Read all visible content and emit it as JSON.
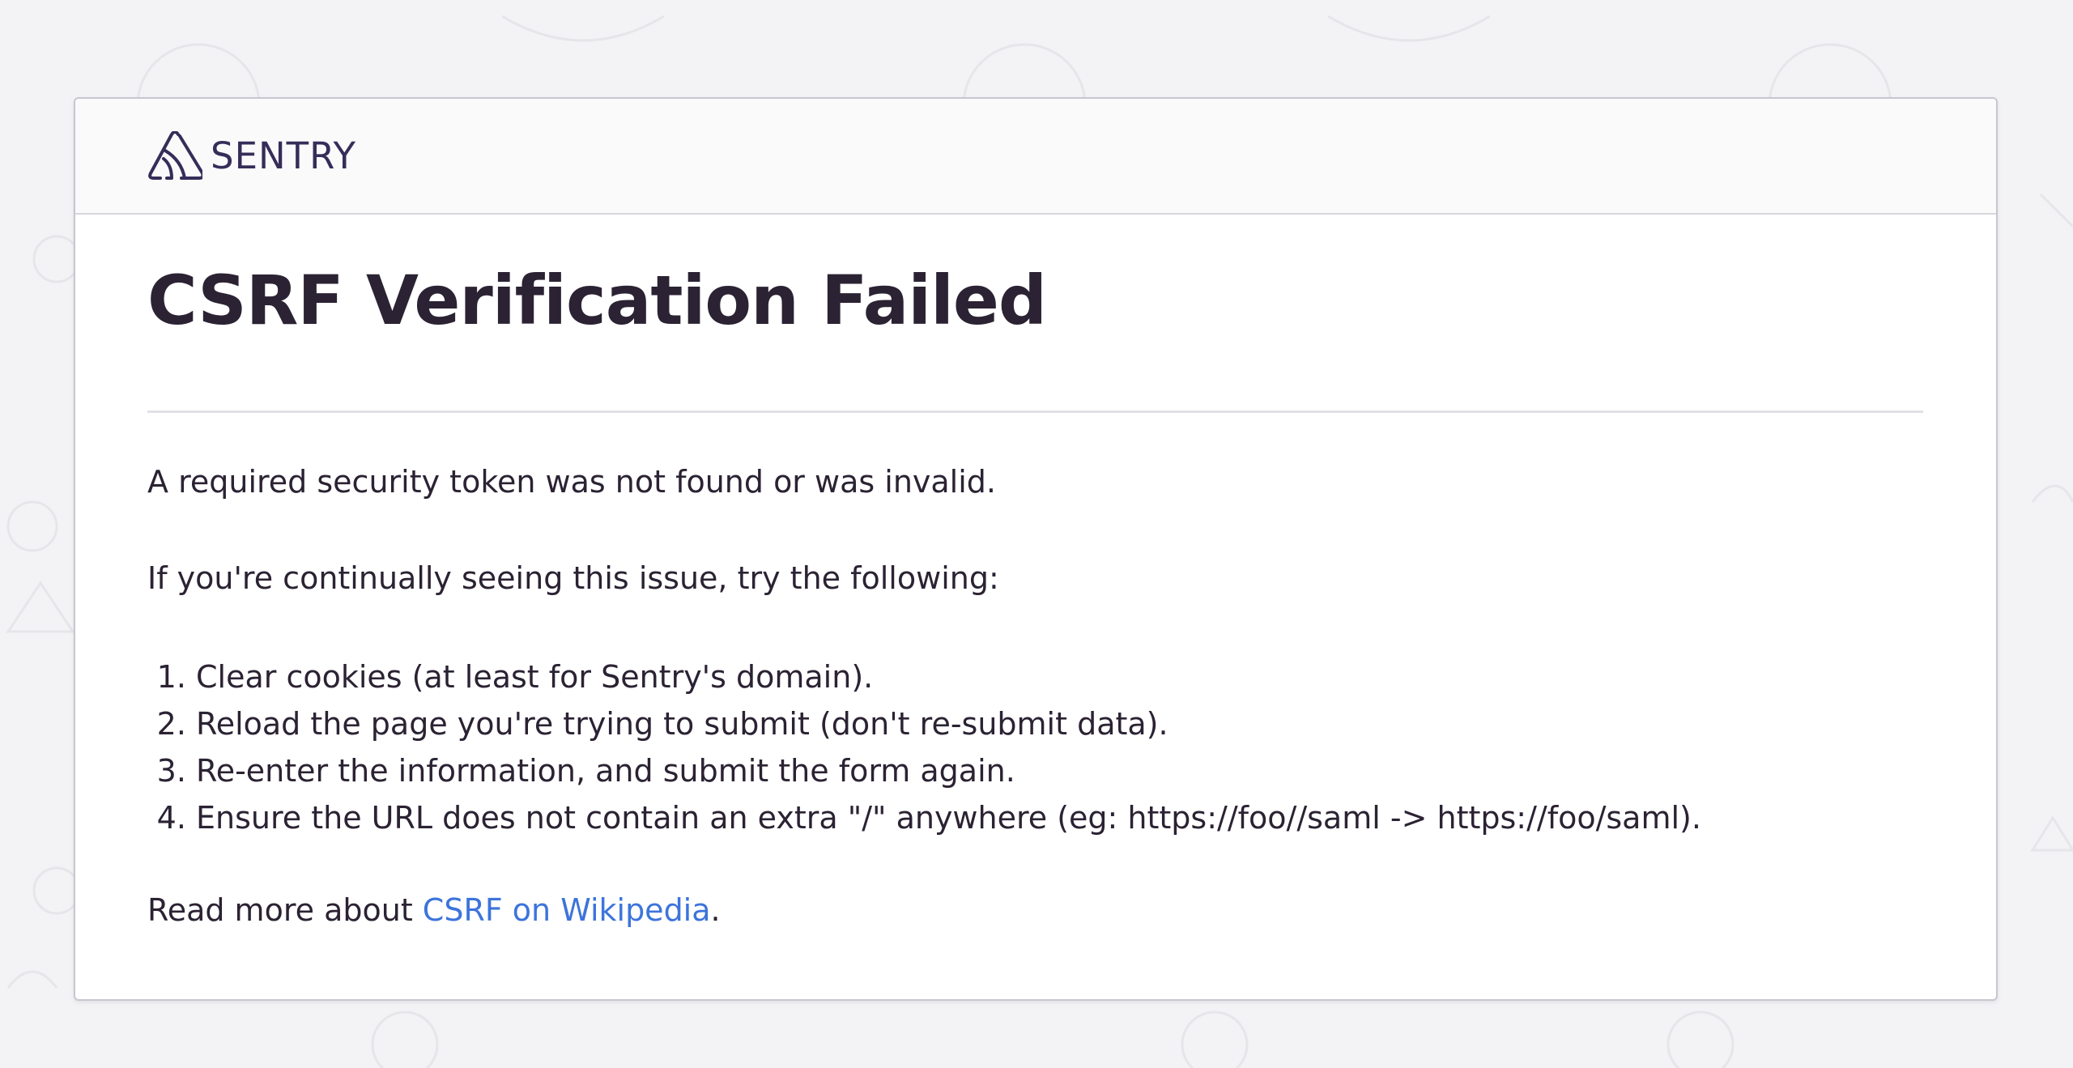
{
  "brand": {
    "name": "SENTRY",
    "logo_icon": "sentry-logo-icon",
    "color": "#362d59"
  },
  "page": {
    "title": "CSRF Verification Failed",
    "intro": "A required security token was not found or was invalid.",
    "lead": "If you're continually seeing this issue, try the following:",
    "steps": [
      "Clear cookies (at least for Sentry's domain).",
      "Reload the page you're trying to submit (don't re-submit data).",
      "Re-enter the information, and submit the form again.",
      "Ensure the URL does not contain an extra \"/\" anywhere (eg: https://foo//saml -> https://foo/saml)."
    ],
    "read_more_prefix": "Read more about ",
    "read_more_link": "CSRF on Wikipedia",
    "read_more_suffix": "."
  },
  "colors": {
    "background": "#f3f3f5",
    "text": "#2b2233",
    "link": "#3d74db",
    "border": "#c9c6d0"
  }
}
